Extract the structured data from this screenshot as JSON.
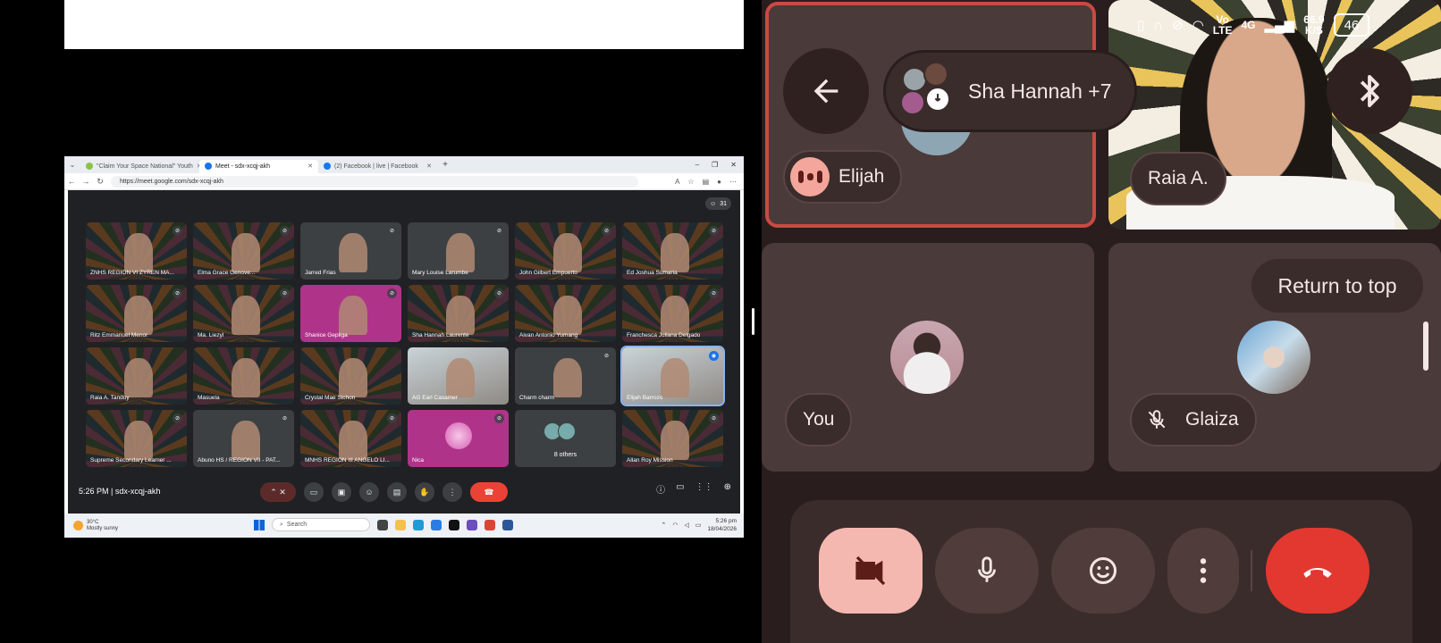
{
  "screenshare": {
    "tabs": [
      {
        "title": "\"Claim Your Space National\" Youth",
        "active": false
      },
      {
        "title": "Meet - sdx-xcqj-akh",
        "active": true
      },
      {
        "title": "(2) Facebook | live | Facebook",
        "active": false
      }
    ],
    "url": "https://meet.google.com/sdx-xcqj-akh",
    "participant_count": "31",
    "tiles": [
      {
        "name": "ZNHS REGION VI ZYREN MA...",
        "style": "rays",
        "muted": true
      },
      {
        "name": "Elma Grace Genove...",
        "style": "rays",
        "muted": true
      },
      {
        "name": "Jarred Frias",
        "style": "plain",
        "muted": true
      },
      {
        "name": "Mary Louise Larumbe",
        "style": "plain",
        "muted": true
      },
      {
        "name": "John Gilbert Empuerto",
        "style": "rays",
        "muted": true
      },
      {
        "name": "Ed Joshua Sumaria",
        "style": "rays",
        "muted": true
      },
      {
        "name": "Ritz Emmanuel Menor",
        "style": "rays",
        "muted": true
      },
      {
        "name": "Ma. Liezyl",
        "style": "rays",
        "muted": true
      },
      {
        "name": "Shanice Gepliga",
        "style": "pink",
        "muted": true
      },
      {
        "name": "Sha Hannah Laurente",
        "style": "rays",
        "muted": true
      },
      {
        "name": "Aivan Antonio Yumang",
        "style": "rays",
        "muted": false
      },
      {
        "name": "Franchesca Juliana Delgado",
        "style": "rays",
        "muted": true
      },
      {
        "name": "Raia A. Tandoy",
        "style": "rays",
        "muted": false
      },
      {
        "name": "Masuela",
        "style": "rays",
        "muted": false
      },
      {
        "name": "Crystal Mae Sichon",
        "style": "rays",
        "muted": false
      },
      {
        "name": "AG Earl Casamer",
        "style": "photo",
        "muted": false
      },
      {
        "name": "Charm charm",
        "style": "plain",
        "muted": true
      },
      {
        "name": "Elijah Barrozo",
        "style": "photo",
        "muted": false,
        "speaking": true
      },
      {
        "name": "Supreme Secondary Learner ...",
        "style": "rays",
        "muted": true
      },
      {
        "name": "Abuno HS / REGION VII - PAT...",
        "style": "plain",
        "muted": true
      },
      {
        "name": "MNHS REGION III ANGELO LI...",
        "style": "rays",
        "muted": true
      },
      {
        "name": "Nica",
        "style": "pink",
        "muted": true,
        "orb": true
      },
      {
        "name": "8 others",
        "style": "plain",
        "muted": false,
        "others": true
      },
      {
        "name": "Allan Roy Mission",
        "style": "rays",
        "muted": true
      }
    ],
    "meeting_time": "5:26 PM",
    "meeting_code": "sdx-xcqj-akh",
    "taskbar": {
      "temperature": "30°C",
      "weather": "Mostly sunny",
      "search": "Search",
      "time": "5:26 pm",
      "date": "18/04/2026"
    }
  },
  "phone": {
    "status": {
      "network_top": "Vo",
      "network_bottom": "LTE",
      "gen": "4G",
      "speed_top": "66.9",
      "speed_bottom": "K/S",
      "battery": "46"
    },
    "group_label": "Sha Hannah +7",
    "tiles": {
      "elijah": "Elijah",
      "raia": "Raia A.",
      "you": "You",
      "glaiza": "Glaiza"
    },
    "return_to_top": "Return to top"
  },
  "colors": {
    "accent_red": "#e2382f",
    "speaking_border": "#c94a42",
    "panel_bg": "#2a1d1e",
    "tile_bg": "#4a3a39"
  }
}
